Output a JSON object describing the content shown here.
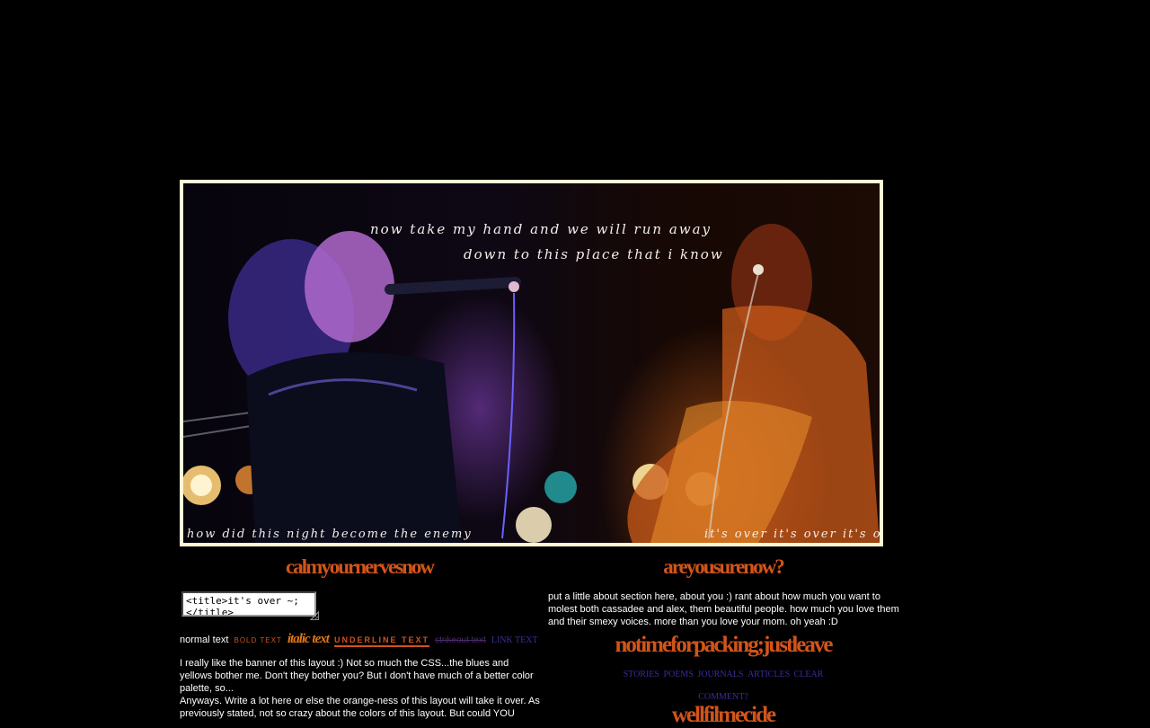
{
  "banner": {
    "lyric_top_1": "now take my hand and we will run away",
    "lyric_top_2": "down to this place that i know",
    "lyric_bottom_left": "how did this night become the enemy",
    "lyric_bottom_right": "it's over it's over it's over"
  },
  "left_column": {
    "heading": "calmyournervesnow",
    "title_box_value": "<title>it's over ~;</title>",
    "styles": {
      "normal": "normal text",
      "bold": "BOLD TEXT",
      "italic": "italic text",
      "underline": "UNDERLINE TEXT",
      "strike": "strikeout text",
      "link": "LINK TEXT"
    },
    "paragraph_1": "I really like the banner of this layout :) Not so much the CSS...the blues and yellows bother me. Don't they bother you? But I don't have much of a better color palette, so...",
    "paragraph_2": "Anyways. Write a lot here or else the orange-ness of this layout will take it over. As previously stated, not so crazy about the colors of this layout. But could YOU"
  },
  "right_column": {
    "heading": "areyousurenow?",
    "about_text": "put a little about section here, about you :) rant about how much you want to molest both cassadee and alex, them beautiful people. how much you love them and their smexy voices. more than you love your mom. oh yeah :D",
    "heading_2": "notimeforpacking;justleave",
    "nav_links": [
      "STORIES",
      "POEMS",
      "JOURNALS",
      "ARTICLES",
      "CLEAR"
    ],
    "comment_link": "COMMENT?",
    "heading_3_partial": "wellfilmecide"
  },
  "colors": {
    "background": "#000000",
    "heading_orange": "#d2541a",
    "link_blue": "#3a2c9a",
    "banner_border": "#fff8d6"
  }
}
